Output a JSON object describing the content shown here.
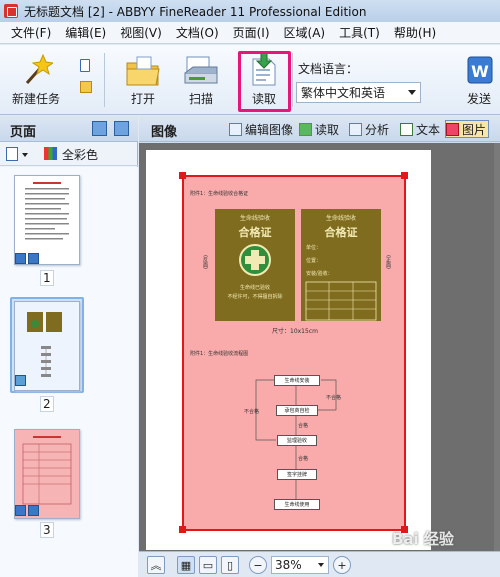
{
  "window": {
    "title": "无标题文档 [2] - ABBYY FineReader 11 Professional Edition"
  },
  "menu": [
    "文件(F)",
    "编辑(E)",
    "视图(V)",
    "文档(O)",
    "页面(I)",
    "区域(A)",
    "工具(T)",
    "帮助(H)"
  ],
  "toolbar": {
    "new_task": "新建任务",
    "open": "打开",
    "scan": "扫描",
    "read": "读取",
    "lang_label": "文档语言：",
    "lang_value": "繁体中文和英语",
    "send": "发送"
  },
  "pages_pane": {
    "title": "页面",
    "color_mode": "全彩色",
    "pages": [
      {
        "number": "1"
      },
      {
        "number": "2",
        "selected": true
      },
      {
        "number": "3"
      }
    ]
  },
  "image_pane": {
    "title": "图像",
    "tools": {
      "edit_image": "编辑图像",
      "read": "读取",
      "analyze": "分析",
      "text": "文本",
      "picture": "图片"
    },
    "zoom": "38%"
  },
  "document": {
    "heading1": "附件1：生命线验收合格证",
    "cert_left": {
      "top": "生命线验收",
      "title": "合格证",
      "side": "(反面)",
      "line1": "生命线已验收",
      "line2": "不经许可，不得擅自拆除"
    },
    "cert_right": {
      "top": "生命线验收",
      "title": "合格证",
      "side": "(正面)",
      "rows": [
        "单位：",
        "位置：",
        "安装/验收："
      ]
    },
    "size": "尺寸：10x15cm",
    "heading2": "附件1：生命线验收流程图",
    "flow": [
      "生命线安装",
      "承包商自检",
      "监理验收",
      "签字挂牌",
      "生命线使用"
    ],
    "flow_labels": {
      "fail": "不合格",
      "ok": "合格"
    }
  },
  "watermark": "Bai 经验",
  "colors": {
    "highlight": "#e8157a",
    "selection": "#e01818",
    "area_fill": "#f9aaaa",
    "cert": "#7f6c1f"
  }
}
